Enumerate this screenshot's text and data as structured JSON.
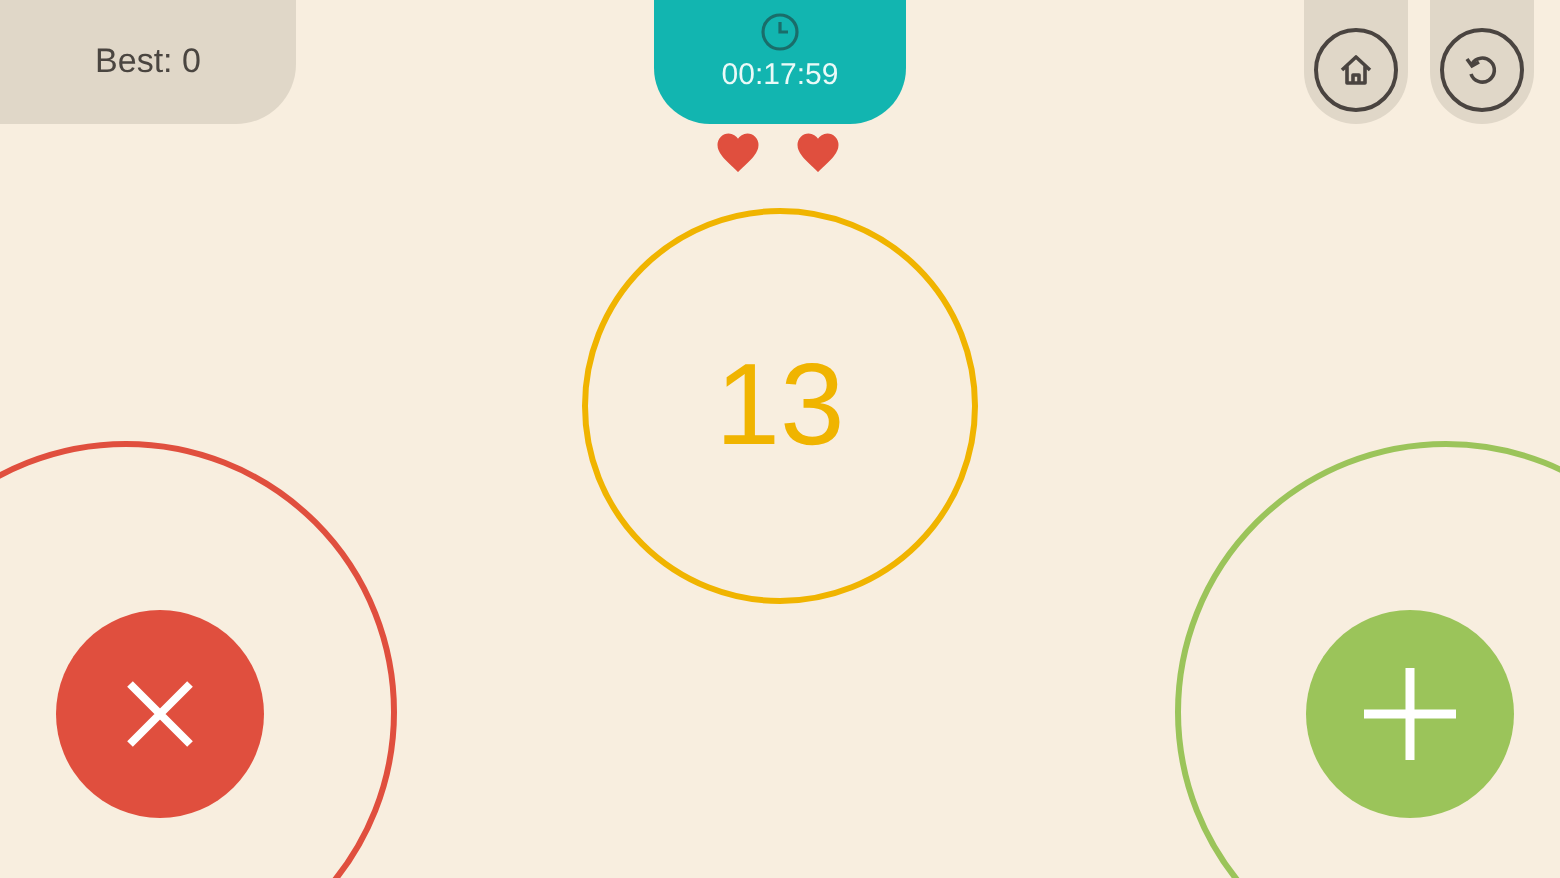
{
  "best": {
    "label": "Best: 0"
  },
  "timer": {
    "time": "00:17:59"
  },
  "hearts": [
    {
      "filled": true
    },
    {
      "filled": true
    }
  ],
  "number": {
    "value": "13"
  },
  "answer_buttons": [
    {
      "kind": "wrong"
    },
    {
      "kind": "right"
    }
  ]
}
